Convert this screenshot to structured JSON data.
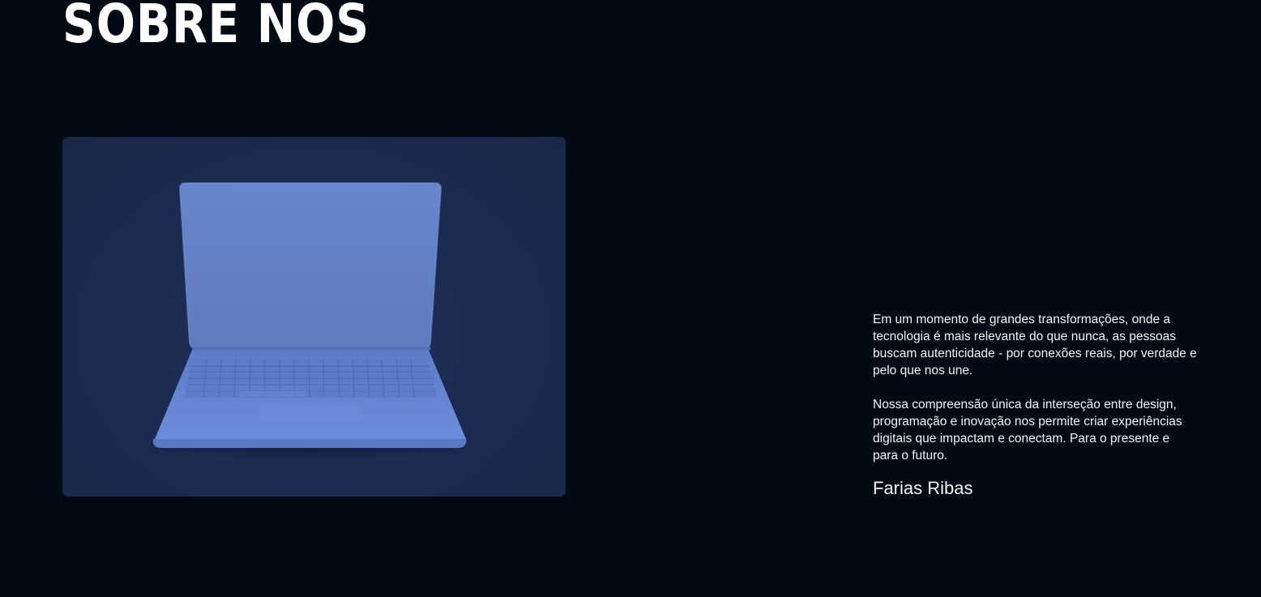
{
  "section": {
    "title": "SOBRE NÓS"
  },
  "image": {
    "icon": "laptop-icon",
    "colors": {
      "background": "#1b2a50",
      "laptop": "#6a8ad8"
    }
  },
  "about": {
    "paragraph_1": "Em um momento de grandes transformações, onde a tecnologia é mais relevante do que nunca, as pessoas buscam autenticidade - por conexões reais, por verdade e pelo que nos une.",
    "paragraph_2": "Nossa compreensão única da interseção entre design, programação e inovação nos permite criar experiências digitais que impactam e conectam. Para o presente e para o futuro.",
    "signature": "Farias Ribas"
  },
  "colors": {
    "page_background": "#020a14",
    "text": "#ffffff"
  }
}
